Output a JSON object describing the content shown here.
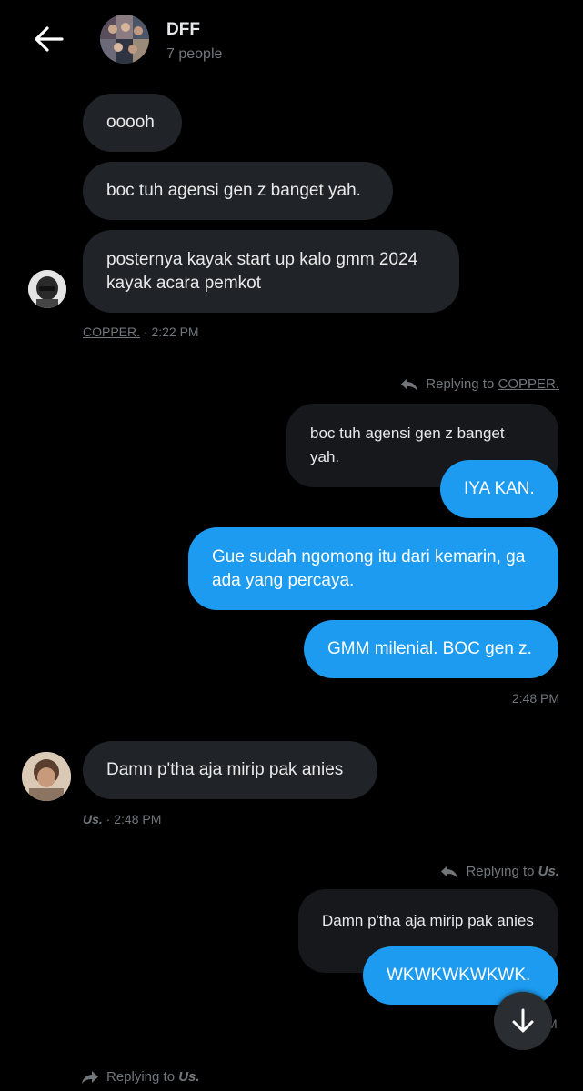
{
  "header": {
    "title": "DFF",
    "subtitle": "7 people"
  },
  "messages": {
    "m1": "ooooh",
    "m2": "boc tuh agensi gen z banget yah.",
    "m3_line1": "posternya kayak start up kalo gmm 2024",
    "m3_line2": "kayak acara pemkot",
    "meta1_name": "COPPER.",
    "meta1_time": " · 2:22 PM",
    "reply1_prefix": "Replying to ",
    "reply1_name": "COPPER.",
    "quote1": "boc tuh agensi gen z banget yah.",
    "o1": "IYA KAN.",
    "o2_line1": "Gue sudah ngomong itu dari kemarin, ga",
    "o2_line2": "ada yang percaya.",
    "o3": "GMM milenial. BOC gen z.",
    "time2": "2:48 PM",
    "m4": "Damn p'tha aja mirip pak anies",
    "meta2_name": "Us.",
    "meta2_time": " · 2:48 PM",
    "reply2_prefix": "Replying to ",
    "reply2_name": "Us.",
    "quote2": "Damn p'tha aja mirip pak anies",
    "o4": "WKWKWKWKWK.",
    "time3_partial": "M",
    "reply3_prefix": "Replying to ",
    "reply3_name": "Us."
  },
  "colors": {
    "background": "#000000",
    "incoming_bubble": "#202327",
    "outgoing_bubble": "#1d9bf0",
    "quote_bubble": "#16181c",
    "muted_text": "#71767b"
  }
}
